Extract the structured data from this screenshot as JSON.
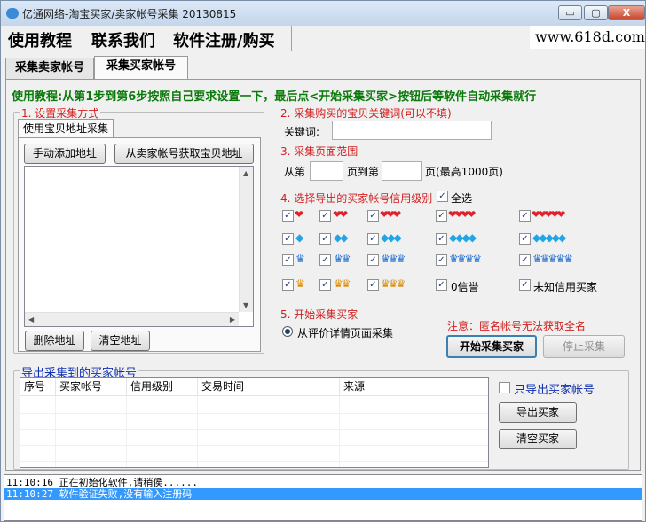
{
  "window": {
    "title": "亿通网络-淘宝买家/卖家帐号采集 20130815",
    "min_glyph": "▭",
    "max_glyph": "▢",
    "close_glyph": "X"
  },
  "menu": {
    "items": [
      "使用教程",
      "联系我们",
      "软件注册/购买"
    ],
    "url_text": "www.618d.com"
  },
  "tabs": [
    "采集卖家帐号",
    "采集买家帐号"
  ],
  "instruction": "使用教程:从第1步到第6步按照自己要求设置一下，最后点<开始采集买家>按钮后等软件自动采集就行",
  "step1": {
    "title": "1. 设置采集方式",
    "inner_tab": "使用宝贝地址采集",
    "btn_manual_add": "手动添加地址",
    "btn_get_from_seller": "从卖家帐号获取宝贝地址",
    "btn_delete": "删除地址",
    "btn_clear": "清空地址"
  },
  "step2": {
    "title": "2. 采集购买的宝贝关键词(可以不填)",
    "keyword_label": "关键词:",
    "keyword_value": ""
  },
  "step3": {
    "title": "3. 采集页面范围",
    "from_label": "从第",
    "mid_label": "页到第",
    "end_label": "页(最高1000页)",
    "from_value": "",
    "to_value": ""
  },
  "step4": {
    "title": "4. 选择导出的买家帐号信用级别",
    "select_all": "全选",
    "zero_credit": "0信誉",
    "unknown_credit": "未知信用买家",
    "icons": {
      "heart": "❤",
      "diamond": "◆",
      "crown": "♛",
      "gold_crown": "♛"
    }
  },
  "step5": {
    "title": "5. 开始采集买家",
    "radio_label": "从评价详情页面采集",
    "notice": "注意：匿名帐号无法获取全名",
    "btn_start": "开始采集买家",
    "btn_stop": "停止采集"
  },
  "export": {
    "title": "导出采集到的买家帐号",
    "columns": [
      "序号",
      "买家帐号",
      "信用级别",
      "交易时间",
      "来源"
    ],
    "only_export_label": "只导出买家帐号",
    "btn_export": "导出买家",
    "btn_clear": "清空买家"
  },
  "log": [
    "11:10:16  正在初始化软件,请稍侯......",
    "11:10:27  软件验证失败,没有输入注册码"
  ]
}
